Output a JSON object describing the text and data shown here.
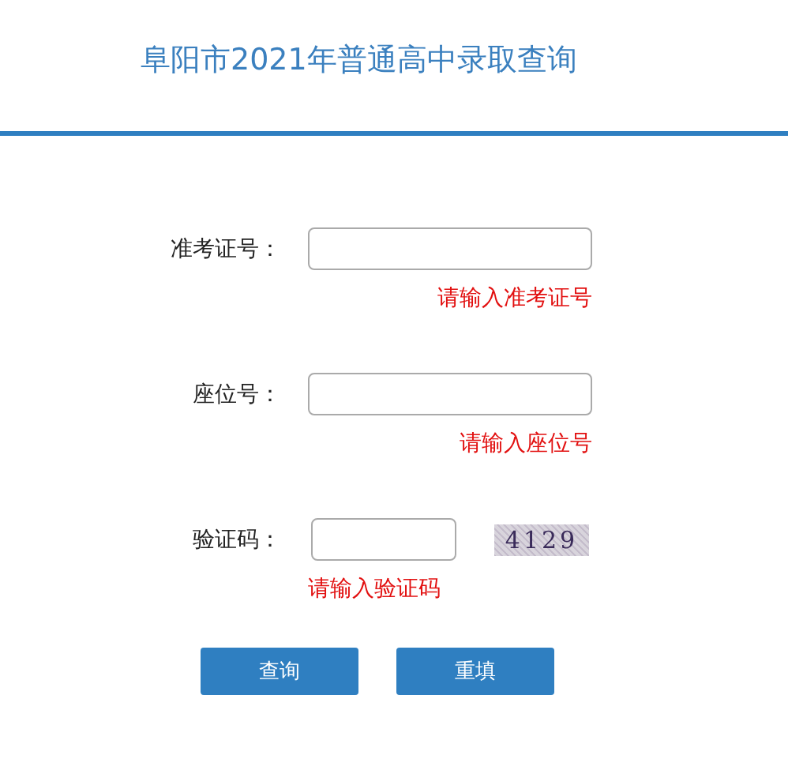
{
  "title": "阜阳市2021年普通高中录取查询",
  "fields": [
    {
      "kind": "text",
      "label": "准考证号：",
      "error": "请输入准考证号"
    },
    {
      "kind": "text",
      "label": "座位号：",
      "error": "请输入座位号"
    },
    {
      "kind": "captcha",
      "label": "验证码：",
      "captcha": "4129",
      "error": "请输入验证码"
    }
  ],
  "buttons": [
    "查询",
    "重填"
  ]
}
